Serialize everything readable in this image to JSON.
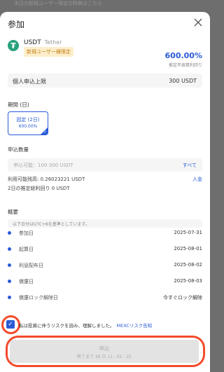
{
  "backdrop_text": "本日の新規ユーザー限定の特典はこちら",
  "modal": {
    "title": "参加"
  },
  "product": {
    "symbol": "USDT",
    "name": "Tether",
    "badge": "新規ユーザー様限定",
    "apr": "600.00%",
    "apr_label": "推定年換算利回り"
  },
  "limit": {
    "label": "個人申込上限",
    "value": "300 USDT"
  },
  "period": {
    "label": "期間 (日)",
    "option_title": "固定 (2日)",
    "option_apr": "600.00%"
  },
  "amount": {
    "label": "申込数量",
    "placeholder": "申込可能：100-300 USDT",
    "all_button": "すべて",
    "available_label": "利用可能残高: 0.26023221 USDT",
    "deposit_link": "入金",
    "estimated": "2日の推定総利回り 0 USDT"
  },
  "overview": {
    "label": "概要",
    "timezone_note": "以下日付はUTC+8を基準としています。",
    "rows": [
      {
        "label": "参加日",
        "value": "2025-07-31"
      },
      {
        "label": "起算日",
        "value": "2025-08-01"
      },
      {
        "label": "利息配布日",
        "value": "2025-08-02"
      },
      {
        "label": "償還日",
        "value": "2025-08-03"
      },
      {
        "label": "償還ロック解除日",
        "value": "今すぐロック解除"
      }
    ]
  },
  "agreement": {
    "text": "私は投資に伴うリスクを読み、理解しました。",
    "link": "MEXCリスク告知"
  },
  "submit": {
    "label": "申込",
    "countdown": "終了まで 26 日 11 : 02 : 25"
  },
  "colors": {
    "accent": "#2a5bd7",
    "highlight": "#f44b2c",
    "badge_bg": "#fdeecb",
    "badge_text": "#c07f14",
    "tether_green": "#26a17b"
  }
}
